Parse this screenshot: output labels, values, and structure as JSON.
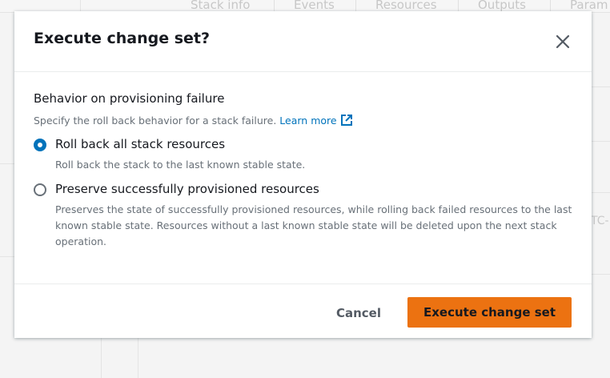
{
  "background": {
    "tabs": [
      "Stack info",
      "Events",
      "Resources",
      "Outputs",
      "Param"
    ],
    "fragment": "TC-"
  },
  "modal": {
    "title": "Execute change set?",
    "close_icon": "close-icon",
    "field": {
      "label": "Behavior on provisioning failure",
      "description": "Specify the roll back behavior for a stack failure.",
      "learn_more": "Learn more",
      "learn_more_icon": "external-link-icon"
    },
    "options": [
      {
        "label": "Roll back all stack resources",
        "description": "Roll back the stack to the last known stable state.",
        "selected": true
      },
      {
        "label": "Preserve successfully provisioned resources",
        "description": "Preserves the state of successfully provisioned resources, while rolling back failed resources to the last known stable state. Resources without a last known stable state will be deleted upon the next stack operation.",
        "selected": false
      }
    ],
    "footer": {
      "cancel_label": "Cancel",
      "execute_label": "Execute change set"
    }
  },
  "colors": {
    "primary_button": "#ec7211",
    "link": "#0073bb",
    "radio_selected": "#0073bb"
  }
}
